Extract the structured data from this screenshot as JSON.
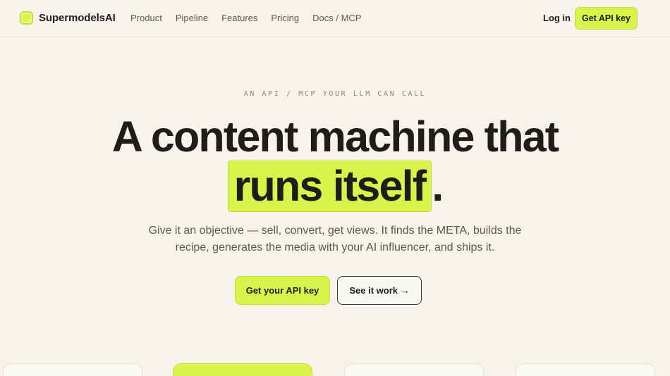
{
  "brand": {
    "name": "SupermodelsAI",
    "accent": "#d9f34a"
  },
  "nav": {
    "links": [
      "Product",
      "Pipeline",
      "Features",
      "Pricing",
      "Docs / MCP"
    ],
    "login": "Log in",
    "cta": "Get API key"
  },
  "hero": {
    "eyebrow": "AN API / MCP YOUR LLM CAN CALL",
    "headline_line1": "A content machine that",
    "headline_highlight": "runs itself",
    "headline_end": ".",
    "subtitle": "Give it an objective — sell, convert, get views. It finds the META, builds the recipe, generates the media with your AI influencer, and ships it.",
    "primary_button": "Get your API key",
    "secondary_button": "See it work →"
  }
}
